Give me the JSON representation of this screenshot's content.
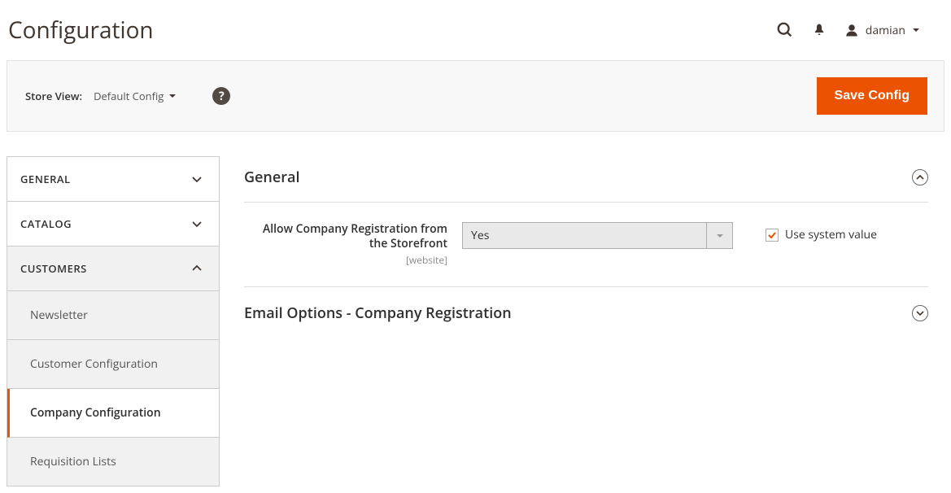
{
  "header": {
    "title": "Configuration",
    "user": "damian"
  },
  "toolbar": {
    "store_view_label": "Store View:",
    "store_view_value": "Default Config",
    "save_label": "Save Config"
  },
  "sidebar": {
    "sections": [
      {
        "title": "GENERAL",
        "expanded": false
      },
      {
        "title": "CATALOG",
        "expanded": false
      },
      {
        "title": "CUSTOMERS",
        "expanded": true,
        "items": [
          {
            "label": "Newsletter",
            "active": false
          },
          {
            "label": "Customer Configuration",
            "active": false
          },
          {
            "label": "Company Configuration",
            "active": true
          },
          {
            "label": "Requisition Lists",
            "active": false
          }
        ]
      }
    ]
  },
  "main": {
    "sections": [
      {
        "title": "General",
        "expanded": true
      },
      {
        "title": "Email Options - Company Registration",
        "expanded": false
      }
    ],
    "fields": {
      "allow_company_registration": {
        "label": "Allow Company Registration from the Storefront",
        "scope": "[website]",
        "value": "Yes",
        "use_system_label": "Use system value",
        "use_system_checked": true
      }
    }
  }
}
